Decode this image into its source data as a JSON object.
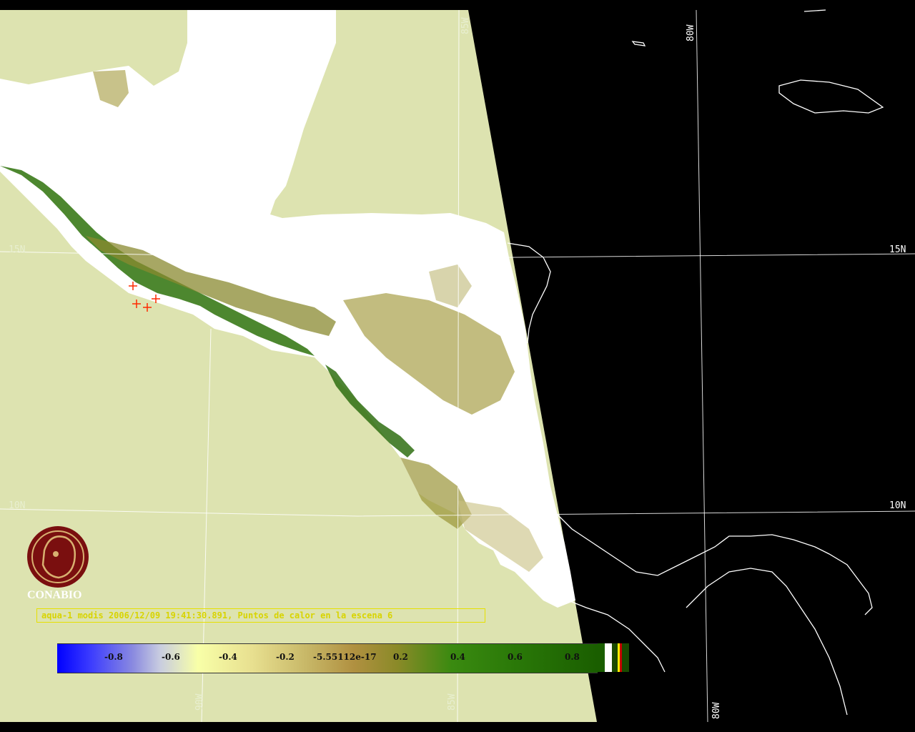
{
  "caption": "aqua-1 modis 2006/12/09 19:41:30.891, Puntos de calor en la escena 6",
  "logo": {
    "text": "CONABIO"
  },
  "grid_labels": {
    "lat_15_left": "15N",
    "lat_15_right": "15N",
    "lat_10_left": "10N",
    "lat_10_right": "10N",
    "lon_85_top": "85W",
    "lon_80_top": "80W",
    "lon_90_bottom": "90W",
    "lon_85_bottom": "85W",
    "lon_80_bottom": "80W"
  },
  "colorscale": {
    "ticks": [
      "-0.8",
      "-0.6",
      "-0.4",
      "-0.2",
      "-5.55112e-17",
      "0.2",
      "0.4",
      "0.6",
      "0.8"
    ]
  },
  "colors": {
    "ocean_scene": "#dde3b0",
    "land_cloud": "#ffffff",
    "vegetation": "#2f6e12",
    "logo": "#7a0f0f",
    "caption": "#d8d400",
    "hotspot_marker": "#ff2a00"
  },
  "icons": [
    "conabio-logo-icon",
    "hotspot-marker-icon"
  ]
}
